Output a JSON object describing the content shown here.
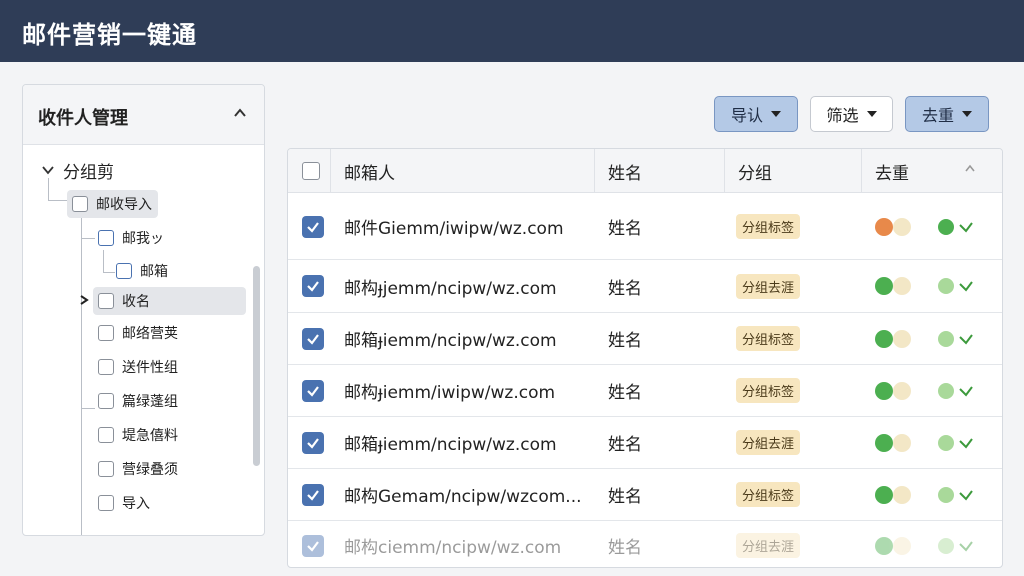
{
  "app": {
    "title": "邮件营销一键通"
  },
  "sidebar": {
    "header": "收件人管理",
    "collapse_icon": "chevron-up-icon",
    "root_label": "分组剪",
    "items": [
      {
        "label": "邮收导入"
      },
      {
        "label": "邮我ッ"
      },
      {
        "label": "邮箱"
      },
      {
        "label": "收名"
      },
      {
        "label": "邮络营荚"
      },
      {
        "label": "送件性组"
      },
      {
        "label": "篇绿蓬组"
      },
      {
        "label": "堤急僖料"
      },
      {
        "label": "营绿叠须"
      },
      {
        "label": "导入"
      }
    ]
  },
  "toolbar": {
    "import_label": "导认",
    "filter_label": "筛选",
    "dedupe_label": "去重"
  },
  "table": {
    "columns": [
      "邮箱人",
      "姓名",
      "分组",
      "去重"
    ],
    "rows": [
      {
        "email": "邮件Giemm/iwipw/wz.com",
        "name": "姓名",
        "group": "分组标签",
        "toggle_color": "#e8894a",
        "status_color": "#4caf50"
      },
      {
        "email": "邮构ɟjemm/ncipw/wz.com",
        "name": "姓名",
        "group": "分组去涯",
        "toggle_color": "#4caf50",
        "status_color": "#a9d99a"
      },
      {
        "email": "邮箱ɟiemm/ncipw/wz.com",
        "name": "姓名",
        "group": "分组标签",
        "toggle_color": "#4caf50",
        "status_color": "#a9d99a"
      },
      {
        "email": "邮构ɟiemm/iwipw/wz.com",
        "name": "姓名",
        "group": "分组标签",
        "toggle_color": "#4caf50",
        "status_color": "#a9d99a"
      },
      {
        "email": "邮箱ɟiemm/ncipw/wz.com",
        "name": "姓名",
        "group": "分組去涯",
        "toggle_color": "#4caf50",
        "status_color": "#a9d99a"
      },
      {
        "email": "邮构Gemam/ncipw/wzcom...",
        "name": "姓名",
        "group": "分组标签",
        "toggle_color": "#4caf50",
        "status_color": "#a9d99a"
      },
      {
        "email": "邮构ciemm/ncipw/wz.com",
        "name": "姓名",
        "group": "分组去涯",
        "toggle_color": "#4caf50",
        "status_color": "#a9d99a"
      }
    ]
  },
  "colors": {
    "titlebar": "#2f3d57",
    "accent_blue": "#4a72b0",
    "badge_bg": "#f7e6bf",
    "status_green": "#3c9a3c"
  }
}
